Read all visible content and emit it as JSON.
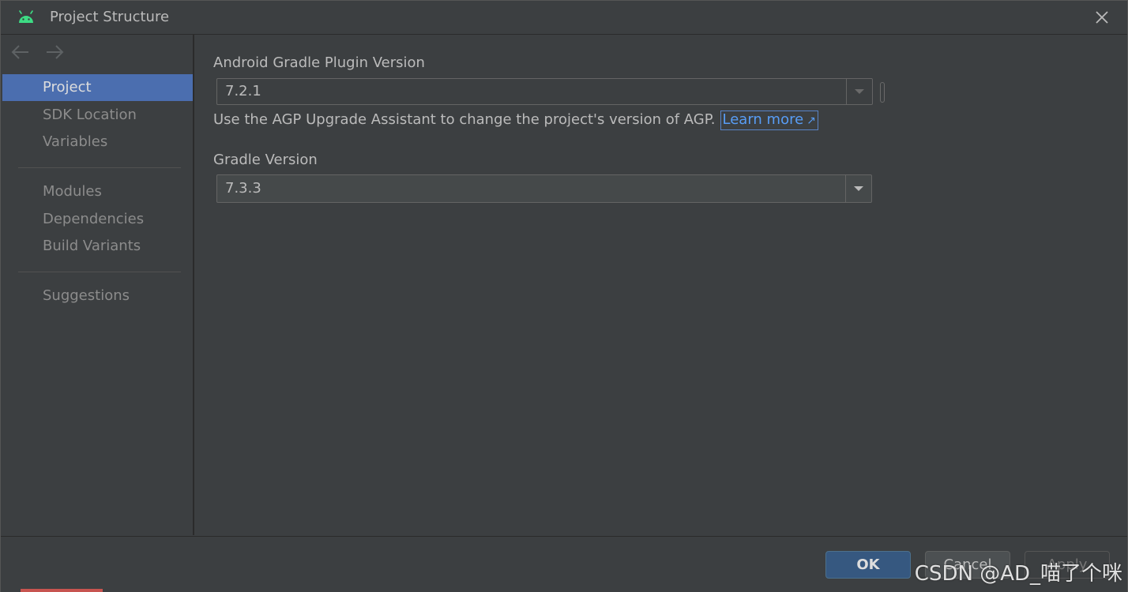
{
  "window": {
    "title": "Project Structure"
  },
  "sidebar": {
    "items": [
      {
        "label": "Project",
        "selected": true
      },
      {
        "label": "SDK Location"
      },
      {
        "label": "Variables"
      },
      {
        "label": "Modules"
      },
      {
        "label": "Dependencies"
      },
      {
        "label": "Build Variants"
      },
      {
        "label": "Suggestions"
      }
    ]
  },
  "main": {
    "agp_label": "Android Gradle Plugin Version",
    "agp_value": "7.2.1",
    "hint_text": "Use the AGP Upgrade Assistant to change the project's version of AGP.",
    "learn_more": "Learn more",
    "learn_more_icon": "↗",
    "gradle_label": "Gradle Version",
    "gradle_value": "7.3.3"
  },
  "footer": {
    "ok": "OK",
    "cancel": "Cancel",
    "apply": "Apply"
  },
  "watermark": "CSDN @AD_喵了个咪",
  "colors": {
    "accent": "#4b6eaf",
    "link": "#589df6",
    "android_green": "#3ddc84",
    "ok_button": "#365880"
  }
}
